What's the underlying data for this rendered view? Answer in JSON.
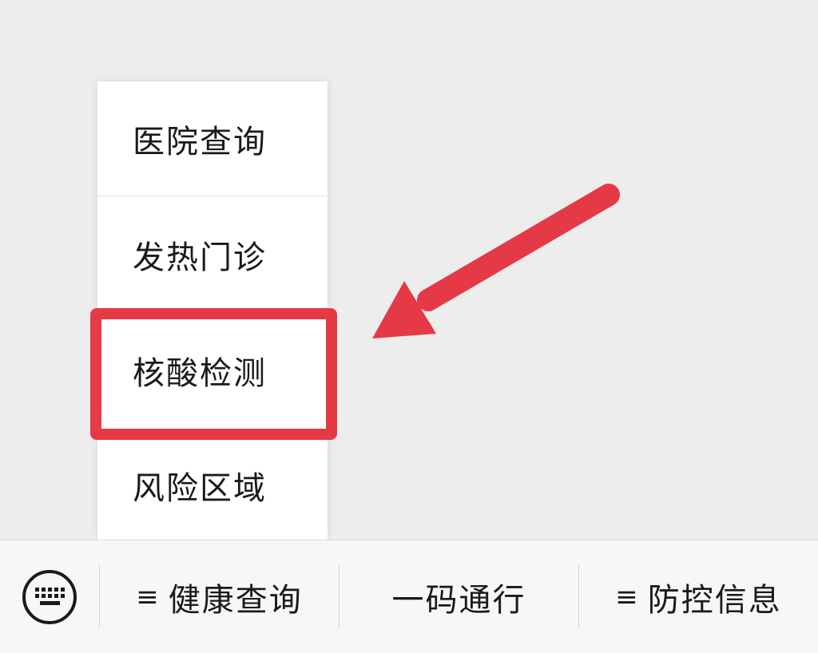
{
  "submenu": {
    "items": [
      {
        "label": "医院查询"
      },
      {
        "label": "发热门诊"
      },
      {
        "label": "核酸检测"
      },
      {
        "label": "风险区域"
      }
    ],
    "highlighted_index": 2
  },
  "annotation": {
    "color": "#e63946"
  },
  "bottom_bar": {
    "keyboard_icon": "keyboard-icon",
    "items": [
      {
        "label": "健康查询",
        "icon": "≡"
      },
      {
        "label": "一码通行"
      },
      {
        "label": "防控信息",
        "icon": "≡"
      }
    ]
  }
}
